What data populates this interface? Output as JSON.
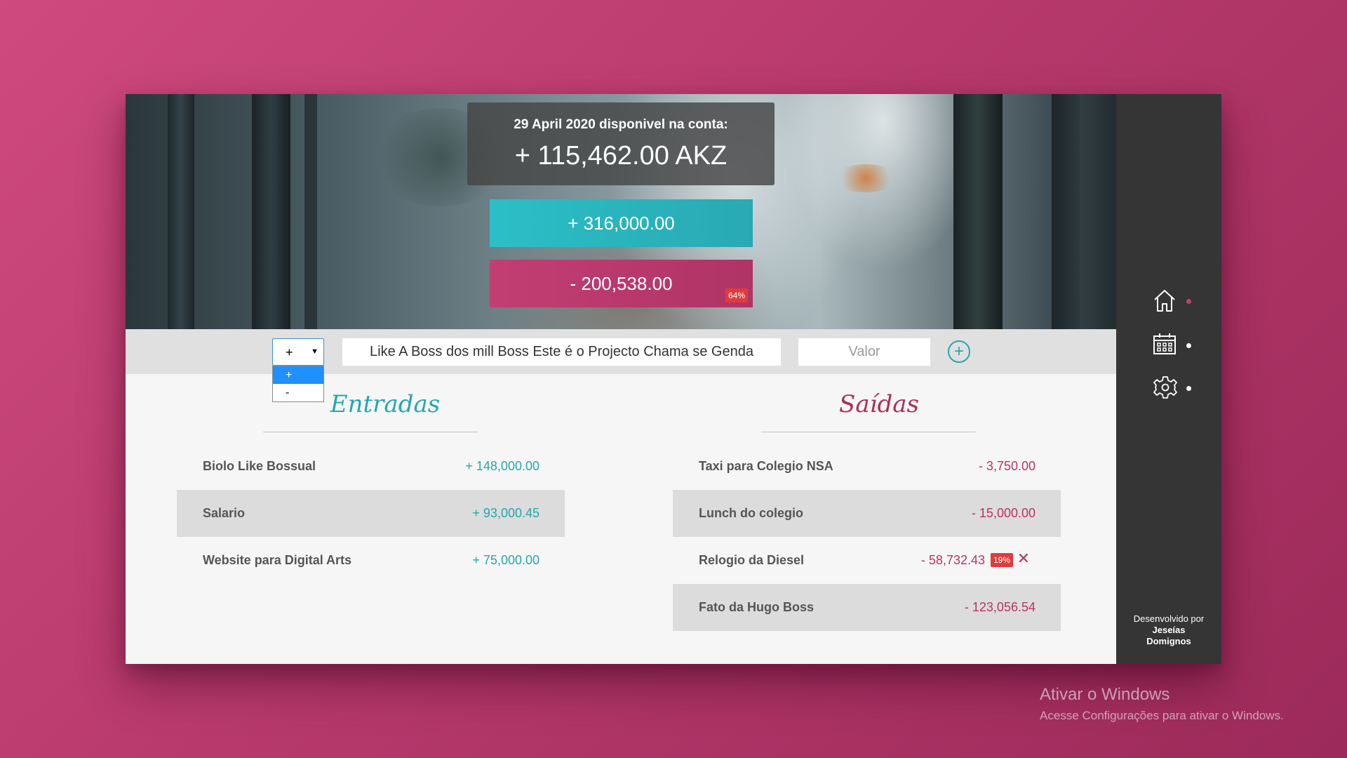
{
  "header": {
    "balance_label": "29 April 2020 disponivel na conta:",
    "balance_value": "+ 115,462.00 AKZ",
    "total_income": "+ 316,000.00",
    "total_expense": "- 200,538.00",
    "expense_percentage": "64%"
  },
  "form": {
    "type_selected": "+",
    "type_options": [
      "+",
      "-"
    ],
    "description_value": "Like A Boss dos mill Boss Este é o Projecto Chama se Genda",
    "value_placeholder": "Valor",
    "add_icon": "plus-circle-icon"
  },
  "income": {
    "title": "Entradas",
    "items": [
      {
        "name": "Biolo Like Bossual",
        "value": "+ 148,000.00"
      },
      {
        "name": "Salario",
        "value": "+ 93,000.45"
      },
      {
        "name": "Website para Digital Arts",
        "value": "+ 75,000.00"
      }
    ]
  },
  "expenses": {
    "title": "Saídas",
    "items": [
      {
        "name": "Taxi para Colegio NSA",
        "value": "- 3,750.00"
      },
      {
        "name": "Lunch do colegio",
        "value": "- 15,000.00"
      },
      {
        "name": "Relogio da Diesel",
        "value": "- 58,732.43",
        "percentage": "19%"
      },
      {
        "name": "Fato da Hugo Boss",
        "value": "- 123,056.54"
      }
    ]
  },
  "sidebar": {
    "nav": [
      {
        "icon": "home-icon",
        "active": true
      },
      {
        "icon": "calendar-icon",
        "active": false
      },
      {
        "icon": "gear-icon",
        "active": false
      }
    ],
    "credit_line1": "Desenvolvido por",
    "credit_line2": "Jeseías",
    "credit_line3": "Domignos"
  },
  "watermark": {
    "title": "Ativar o Windows",
    "subtitle": "Acesse Configurações para ativar o Windows."
  },
  "colors": {
    "income_accent": "#26a6ae",
    "expense_accent": "#b8345f",
    "sidebar_bg": "#353535",
    "active_dot": "#c23e73"
  }
}
